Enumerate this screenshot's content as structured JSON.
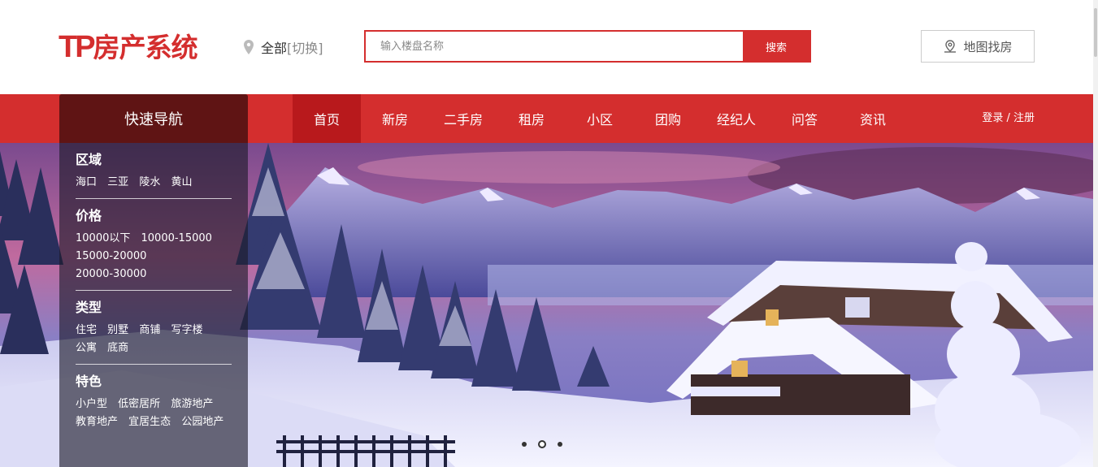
{
  "header": {
    "logo_tp": "TP",
    "logo_text": "房产系统",
    "city_current": "全部",
    "city_switch": "[切换]",
    "search_placeholder": "输入楼盘名称",
    "search_button": "搜索",
    "map_button": "地图找房"
  },
  "nav": {
    "items": [
      "首页",
      "新房",
      "二手房",
      "租房",
      "小区",
      "团购",
      "经纪人",
      "问答",
      "资讯"
    ],
    "active_index": 0,
    "login": "登录 / 注册"
  },
  "quick_nav": {
    "title": "快速导航",
    "sections": [
      {
        "title": "区域",
        "links": [
          "海口",
          "三亚",
          "陵水",
          "黄山"
        ]
      },
      {
        "title": "价格",
        "links": [
          "10000以下",
          "10000-15000",
          "15000-20000",
          "20000-30000"
        ]
      },
      {
        "title": "类型",
        "links": [
          "住宅",
          "别墅",
          "商铺",
          "写字楼",
          "公寓",
          "底商"
        ]
      },
      {
        "title": "特色",
        "links": [
          "小户型",
          "低密居所",
          "旅游地产",
          "教育地产",
          "宜居生态",
          "公园地产"
        ]
      }
    ]
  },
  "banner": {
    "slide_count": 3,
    "active_slide": 1
  },
  "colors": {
    "brand_red": "#d42e2e",
    "nav_active": "#b8191c",
    "quick_head": "#5f1414"
  }
}
